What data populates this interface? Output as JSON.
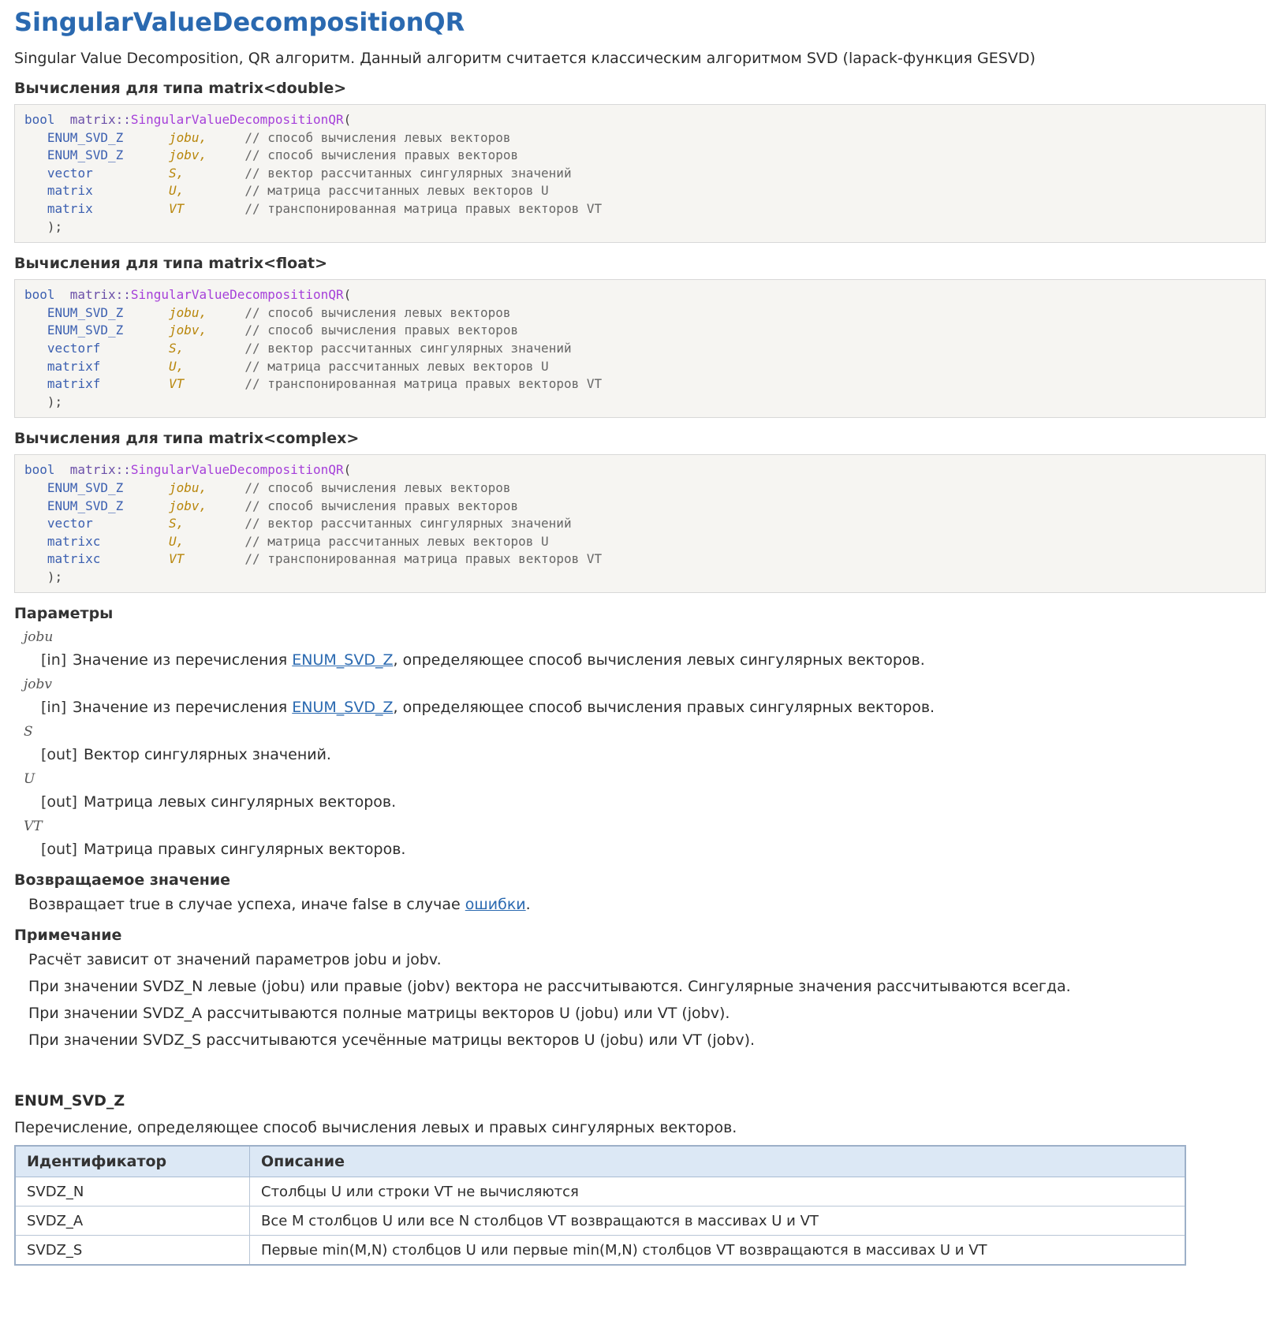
{
  "title": "SingularValueDecompositionQR",
  "intro": "Singular Value Decomposition, QR алгоритм. Данный алгоритм считается классическим алгоритмом SVD (lapack-функция GESVD)",
  "sections": [
    {
      "heading": "Вычисления для типа matrix<double>",
      "ret_type": "bool",
      "class_prefix": "matrix::",
      "func": "SingularValueDecompositionQR",
      "lines": [
        {
          "type": "ENUM_SVD_Z",
          "name": "jobu,",
          "comment": "// способ вычисления левых векторов"
        },
        {
          "type": "ENUM_SVD_Z",
          "name": "jobv,",
          "comment": "// способ вычисления правых векторов"
        },
        {
          "type": "vector",
          "name": "S,",
          "comment": "// вектор рассчитанных сингулярных значений"
        },
        {
          "type": "matrix",
          "name": "U,",
          "comment": "// матрица рассчитанных левых векторов U"
        },
        {
          "type": "matrix",
          "name": "VT",
          "comment": "// транспонированная матрица правых векторов VT"
        }
      ]
    },
    {
      "heading": "Вычисления для типа matrix<float>",
      "ret_type": "bool",
      "class_prefix": "matrix::",
      "func": "SingularValueDecompositionQR",
      "lines": [
        {
          "type": "ENUM_SVD_Z",
          "name": "jobu,",
          "comment": "// способ вычисления левых векторов"
        },
        {
          "type": "ENUM_SVD_Z",
          "name": "jobv,",
          "comment": "// способ вычисления правых векторов"
        },
        {
          "type": "vectorf",
          "name": "S,",
          "comment": "// вектор рассчитанных сингулярных значений"
        },
        {
          "type": "matrixf",
          "name": "U,",
          "comment": "// матрица рассчитанных левых векторов U"
        },
        {
          "type": "matrixf",
          "name": "VT",
          "comment": "// транспонированная матрица правых векторов VT"
        }
      ]
    },
    {
      "heading": "Вычисления для типа matrix<complex>",
      "ret_type": "bool",
      "class_prefix": "matrix::",
      "func": "SingularValueDecompositionQR",
      "lines": [
        {
          "type": "ENUM_SVD_Z",
          "name": "jobu,",
          "comment": "// способ вычисления левых векторов"
        },
        {
          "type": "ENUM_SVD_Z",
          "name": "jobv,",
          "comment": "// способ вычисления правых векторов"
        },
        {
          "type": "vector",
          "name": "S,",
          "comment": "// вектор рассчитанных сингулярных значений"
        },
        {
          "type": "matrixc",
          "name": "U,",
          "comment": "// матрица рассчитанных левых векторов U"
        },
        {
          "type": "matrixc",
          "name": "VT",
          "comment": "// транспонированная матрица правых векторов VT"
        }
      ]
    }
  ],
  "params_heading": "Параметры",
  "params": [
    {
      "name": "jobu",
      "tag": "[in]",
      "pre": "Значение из перечисления ",
      "link": "ENUM_SVD_Z",
      "post": ", определяющее способ вычисления левых сингулярных векторов."
    },
    {
      "name": "jobv",
      "tag": "[in]",
      "pre": "Значение из перечисления ",
      "link": "ENUM_SVD_Z",
      "post": ", определяющее способ вычисления правых сингулярных векторов."
    },
    {
      "name": "S",
      "tag": "[out]",
      "pre": "Вектор сингулярных значений.",
      "link": "",
      "post": ""
    },
    {
      "name": "U",
      "tag": "[out]",
      "pre": "Матрица левых сингулярных векторов.",
      "link": "",
      "post": ""
    },
    {
      "name": "VT",
      "tag": "[out]",
      "pre": "Матрица правых сингулярных векторов.",
      "link": "",
      "post": ""
    }
  ],
  "return_heading": "Возвращаемое значение",
  "return_pre": "Возвращает true в случае успеха, иначе false в случае ",
  "return_link": "ошибки",
  "return_post": ".",
  "note_heading": "Примечание",
  "notes": [
    "Расчёт зависит от значений параметров jobu и jobv.",
    "При значении SVDZ_N левые (jobu) или правые (jobv) вектора не рассчитываются. Сингулярные значения рассчитываются всегда.",
    "При значении SVDZ_A рассчитываются полные матрицы векторов U (jobu) или VT (jobv).",
    "При значении SVDZ_S рассчитываются усечённые матрицы векторов U (jobu) или VT (jobv)."
  ],
  "enum_heading": "ENUM_SVD_Z",
  "enum_desc": "Перечисление, определяющее способ вычисления левых и правых сингулярных векторов.",
  "enum_table": {
    "headers": [
      "Идентификатор",
      "Описание"
    ],
    "rows": [
      [
        "SVDZ_N",
        "Столбцы U или строки VT не вычисляются"
      ],
      [
        "SVDZ_A",
        "Все M столбцов U или все N столбцов VT возвращаются в массивах U и VT"
      ],
      [
        "SVDZ_S",
        "Первые min(M,N) столбцов U или первые min(M,N) столбцов VT возвращаются в массивах U и VT"
      ]
    ]
  },
  "colors": {
    "title": "#2a69b0",
    "link": "#2a69b0",
    "code_bg": "#f6f5f2",
    "table_header_bg": "#dce8f5"
  }
}
